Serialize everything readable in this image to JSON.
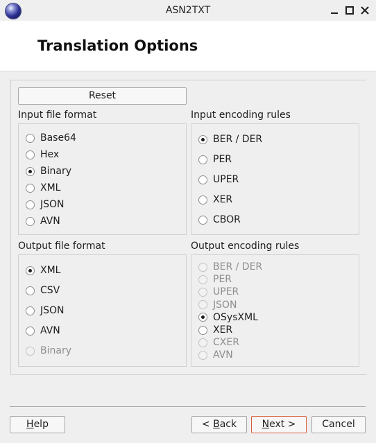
{
  "window": {
    "title": "ASN2TXT",
    "controls": [
      "minimize-icon",
      "maximize-icon",
      "close-icon"
    ]
  },
  "header": {
    "page_title": "Translation Options"
  },
  "reset_label": "Reset",
  "input_file_format": {
    "label": "Input file format",
    "options": [
      {
        "label": "Base64",
        "checked": false,
        "disabled": false
      },
      {
        "label": "Hex",
        "checked": false,
        "disabled": false
      },
      {
        "label": "Binary",
        "checked": true,
        "disabled": false
      },
      {
        "label": "XML",
        "checked": false,
        "disabled": false
      },
      {
        "label": "JSON",
        "checked": false,
        "disabled": false
      },
      {
        "label": "AVN",
        "checked": false,
        "disabled": false
      }
    ]
  },
  "input_encoding_rules": {
    "label": "Input encoding rules",
    "options": [
      {
        "label": "BER / DER",
        "checked": true,
        "disabled": false
      },
      {
        "label": "PER",
        "checked": false,
        "disabled": false
      },
      {
        "label": "UPER",
        "checked": false,
        "disabled": false
      },
      {
        "label": "XER",
        "checked": false,
        "disabled": false
      },
      {
        "label": "CBOR",
        "checked": false,
        "disabled": false
      }
    ]
  },
  "output_file_format": {
    "label": "Output file format",
    "options": [
      {
        "label": "XML",
        "checked": true,
        "disabled": false
      },
      {
        "label": "CSV",
        "checked": false,
        "disabled": false
      },
      {
        "label": "JSON",
        "checked": false,
        "disabled": false
      },
      {
        "label": "AVN",
        "checked": false,
        "disabled": false
      },
      {
        "label": "Binary",
        "checked": false,
        "disabled": true
      }
    ]
  },
  "output_encoding_rules": {
    "label": "Output encoding rules",
    "options": [
      {
        "label": "BER / DER",
        "checked": false,
        "disabled": true
      },
      {
        "label": "PER",
        "checked": false,
        "disabled": true
      },
      {
        "label": "UPER",
        "checked": false,
        "disabled": true
      },
      {
        "label": "JSON",
        "checked": false,
        "disabled": true
      },
      {
        "label": "OSysXML",
        "checked": true,
        "disabled": false
      },
      {
        "label": "XER",
        "checked": false,
        "disabled": false
      },
      {
        "label": "CXER",
        "checked": false,
        "disabled": true
      },
      {
        "label": "AVN",
        "checked": false,
        "disabled": true
      }
    ]
  },
  "buttons": {
    "help": {
      "mnemonic": "H",
      "rest": "elp"
    },
    "back": {
      "prefix": "< ",
      "mnemonic": "B",
      "rest": "ack"
    },
    "next": {
      "mnemonic": "N",
      "rest": "ext >"
    },
    "cancel": "Cancel"
  },
  "colors": {
    "default_button_border": "#d85a3c"
  }
}
